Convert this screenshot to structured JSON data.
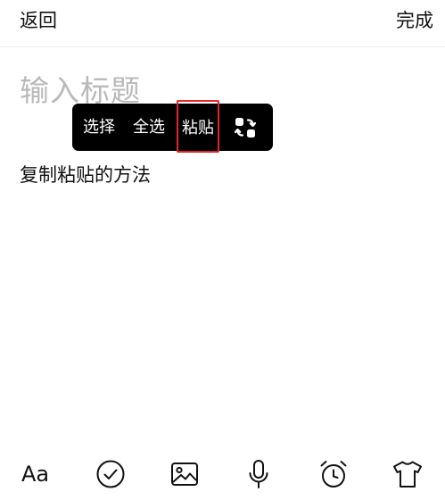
{
  "header": {
    "back_label": "返回",
    "done_label": "完成"
  },
  "editor": {
    "title_placeholder": "输入标题",
    "body_text": "复制粘贴的方法"
  },
  "context_menu": {
    "items": [
      {
        "label": "选择"
      },
      {
        "label": "全选"
      },
      {
        "label": "粘贴",
        "highlighted": true
      }
    ],
    "swap_icon": "swap-arrows-icon",
    "highlight_color": "#e0262b"
  },
  "toolbar": {
    "text_format_label": "Aa",
    "icons": [
      "text-format-icon",
      "checklist-icon",
      "image-icon",
      "microphone-icon",
      "alarm-clock-icon",
      "theme-shirt-icon"
    ]
  }
}
